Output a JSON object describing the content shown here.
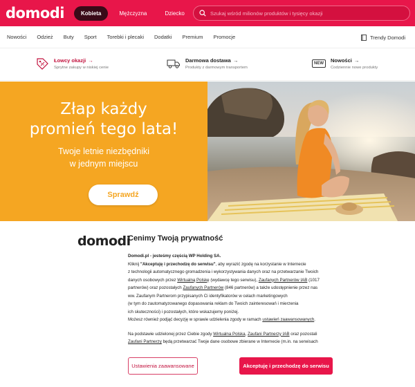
{
  "header": {
    "logo": "domodi",
    "tabs": [
      {
        "label": "Kobieta",
        "active": true
      },
      {
        "label": "Mężczyzna",
        "active": false
      },
      {
        "label": "Dziecko",
        "active": false
      }
    ],
    "search_placeholder": "Szukaj wśród milionów produktów i tysięcy okazji",
    "brand_color": "#e8164a"
  },
  "nav": {
    "items": [
      "Nowości",
      "Odzież",
      "Buty",
      "Sport",
      "Torebki i plecaki",
      "Dodatki",
      "Premium",
      "Promocje"
    ],
    "right_label": "Trendy Domodi"
  },
  "features": [
    {
      "title": "Łowcy okazji",
      "subtitle": "Sprytne zakupy w niskiej cenie",
      "icon": "percent-tag-icon"
    },
    {
      "title": "Darmowa dostawa",
      "subtitle": "Produkty z darmowym transportem",
      "icon": "truck-icon"
    },
    {
      "title": "Nowości",
      "subtitle": "Codziennie nowe produkty",
      "icon": "new-badge-icon",
      "badge": "NEW"
    }
  ],
  "hero": {
    "title_line1": "Złap każdy",
    "title_line2": "promień tego lata!",
    "subtitle_line1": "Twoje letnie niezbędniki",
    "subtitle_line2": "w jednym miejscu",
    "button": "Sprawdź",
    "bg_color": "#f5a622"
  },
  "consent": {
    "logo": "domodi",
    "title": "Cenimy Twoją prywatność",
    "intro": "Domodi.pl - jesteśmy częścią WP Holding SA.",
    "p1_a": "Kliknij ",
    "p1_b": "\"Akceptuję i przechodzę do serwisu\"",
    "p1_c": ", aby wyrazić zgodę na korzystanie w Internecie",
    "p1_d": "z technologii automatycznego gromadzenia i wykorzystywania danych oraz na przetwarzanie Twoich",
    "p1_e": "danych osobowych przez ",
    "link_wirtualna": "Wirtualną Polskę",
    "p1_f": " (wydawcę tego serwisu), ",
    "link_iab": "Zaufanych Partnerów IAB",
    "p1_g": " (1017",
    "p1_h": "partnerów) oraz pozostałych ",
    "link_partners": "Zaufanych Partnerów",
    "p1_i": " (846 partnerów) a także udostępnienie przez nas",
    "p1_j": "ww. Zaufanym Partnerom przypisanych Ci identyfikatorów w celach marketingowych",
    "p1_k": "(w tym do zautomatyzowanego dopasowania reklam do Twoich zainteresowań i mierzenia",
    "p1_l": "ich skuteczności) i pozostałych, które wskazujemy poniżej.",
    "p1_m": "Możesz również podjąć decyzję w sprawie udzielenia zgody w ramach ",
    "link_advanced": "ustawień zaawansowanych",
    "p1_n": ".",
    "p2_a": "Na podstawie udzielonej przez Ciebie zgody ",
    "link_wirtualna2": "Wirtualna Polska",
    "p2_b": ", ",
    "link_iab2": "Zaufani Partnerzy IAB",
    "p2_c": " oraz pozostali",
    "link_partners2": "Zaufani Partnerzy",
    "p2_d": " będą przetwarzać Twoje dane osobowe zbierane w Internecie (m.in. na serwisach",
    "btn_settings": "Ustawienia zaawansowane",
    "btn_accept": "Akceptuję i przechodzę do serwisu"
  }
}
